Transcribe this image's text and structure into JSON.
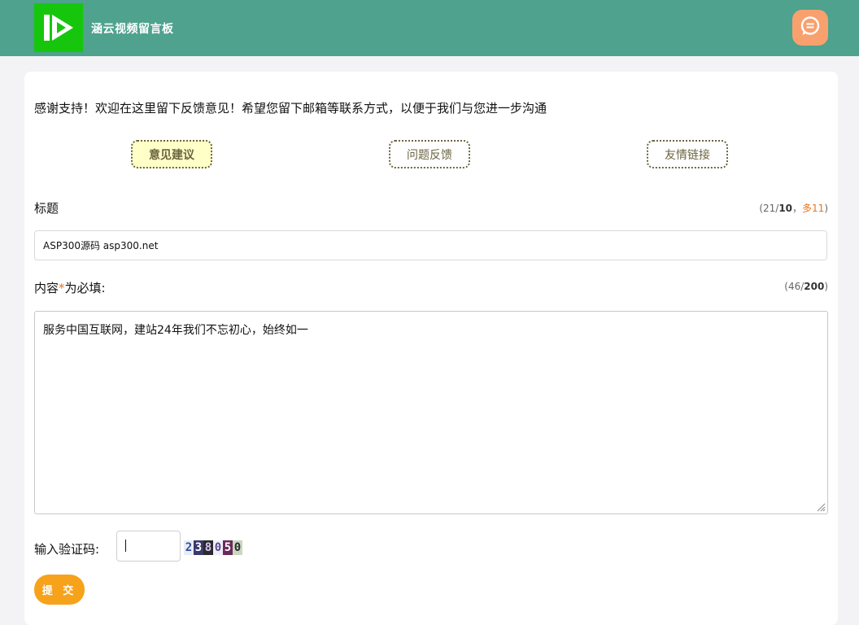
{
  "header": {
    "site_title": "涵云视频留言板",
    "logo_icon": "play-logo-icon",
    "message_icon": "chat-bubble-icon",
    "colors": {
      "bar": "#4ea28e",
      "logo": "#16c60c",
      "message_button": "#f9a06f"
    }
  },
  "intro": "感谢支持！欢迎在这里留下反馈意见！希望您留下邮箱等联系方式，以便于我们与您进一步沟通",
  "tabs": [
    {
      "label": "意见建议",
      "active": true
    },
    {
      "label": "问题反馈",
      "active": false
    },
    {
      "label": "友情链接",
      "active": false
    }
  ],
  "title_field": {
    "label": "标题",
    "value": "ASP300源码 asp300.net",
    "counter": {
      "open": "(",
      "current": "21/",
      "max": "10",
      "sep": "，",
      "over": "多11",
      "close": ")"
    }
  },
  "content_field": {
    "label_prefix": "内容",
    "required_mark": "*",
    "label_suffix": "为必填:",
    "value": "服务中国互联网，建站24年我们不忘初心，始终如一",
    "counter": {
      "open": "(",
      "current": "46/",
      "max": "200",
      "close": ")"
    }
  },
  "captcha": {
    "label": "输入验证码:",
    "value": "",
    "code": "238050"
  },
  "submit_label": "提 交",
  "accent": {
    "submit": "#f7a21b",
    "warn": "#e8741a"
  }
}
